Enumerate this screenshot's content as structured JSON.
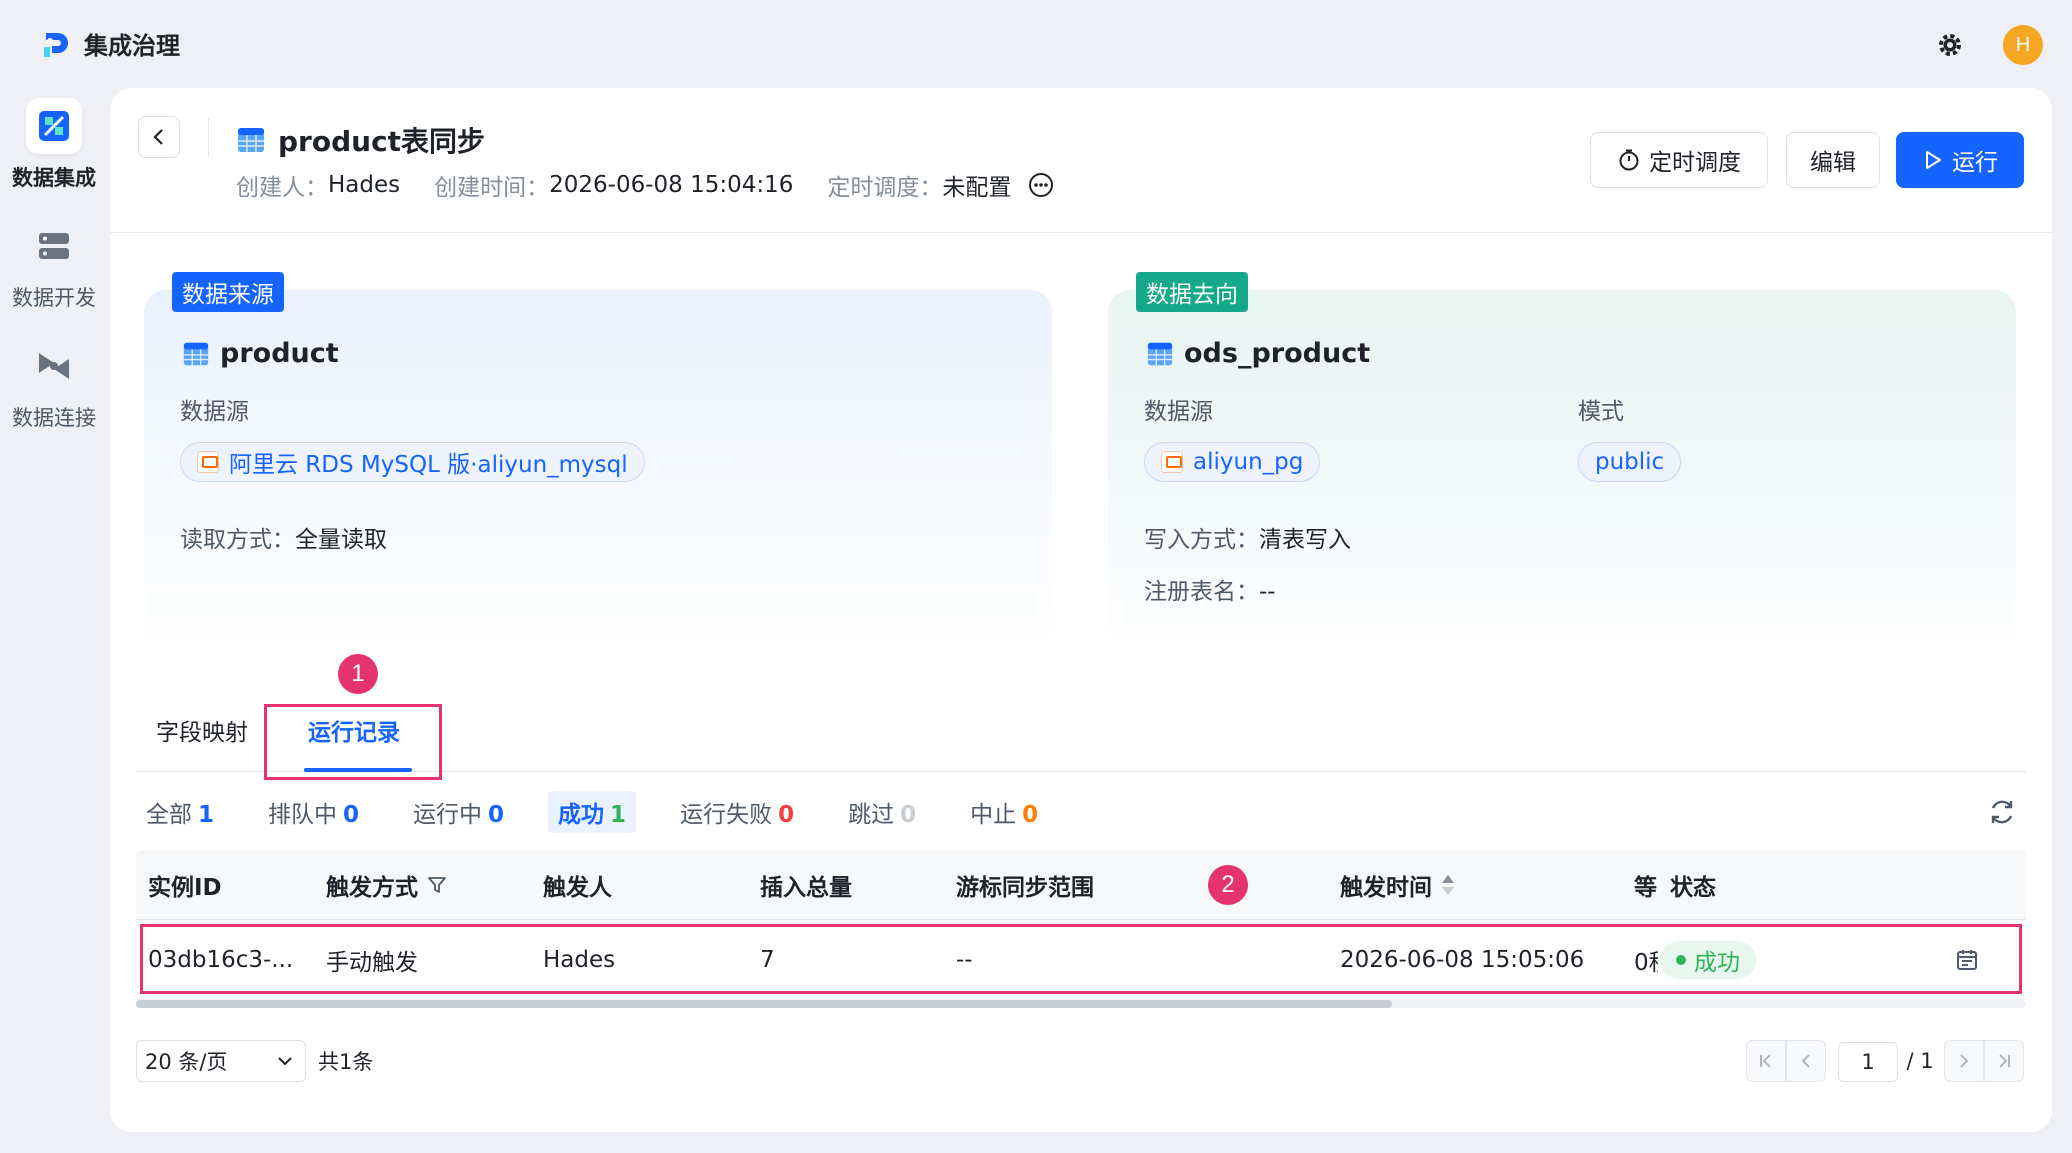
{
  "app": {
    "name": "集成治理",
    "avatar_letter": "H"
  },
  "sidebar": {
    "items": [
      {
        "label": "数据集成",
        "icon": "data-integration-icon",
        "active": true
      },
      {
        "label": "数据开发",
        "icon": "data-development-icon",
        "active": false
      },
      {
        "label": "数据连接",
        "icon": "data-connection-icon",
        "active": false
      }
    ]
  },
  "task": {
    "title": "product表同步",
    "creator_label": "创建人：",
    "creator": "Hades",
    "created_label": "创建时间：",
    "created_at": "2026-06-08 15:04:16",
    "schedule_label": "定时调度：",
    "schedule": "未配置"
  },
  "actions": {
    "schedule": "定时调度",
    "edit": "编辑",
    "run": "运行"
  },
  "source": {
    "tag": "数据来源",
    "table": "product",
    "datasource_label": "数据源",
    "datasource": "阿里云 RDS MySQL 版·aliyun_mysql",
    "read_mode_label": "读取方式：",
    "read_mode": "全量读取"
  },
  "target": {
    "tag": "数据去向",
    "table": "ods_product",
    "datasource_label": "数据源",
    "datasource": "aliyun_pg",
    "schema_label": "模式",
    "schema": "public",
    "write_mode_label": "写入方式：",
    "write_mode": "清表写入",
    "registered_label": "注册表名：",
    "registered": "--"
  },
  "tabs": [
    {
      "label": "字段映射",
      "active": false
    },
    {
      "label": "运行记录",
      "active": true
    }
  ],
  "annotations": {
    "one": "1",
    "two": "2"
  },
  "filters": [
    {
      "label": "全部",
      "count": "1",
      "color": "#1664ff"
    },
    {
      "label": "排队中",
      "count": "0",
      "color": "#1664ff"
    },
    {
      "label": "运行中",
      "count": "0",
      "color": "#1664ff"
    },
    {
      "label": "成功",
      "count": "1",
      "color": "#2fb45a",
      "active": true
    },
    {
      "label": "运行失败",
      "count": "0",
      "color": "#f53f3f"
    },
    {
      "label": "跳过",
      "count": "0",
      "color": "#c9cdd4"
    },
    {
      "label": "中止",
      "count": "0",
      "color": "#ff7d00"
    }
  ],
  "table": {
    "columns": [
      "实例ID",
      "触发方式",
      "触发人",
      "插入总量",
      "游标同步范围",
      "触发时间",
      "等",
      "状态"
    ],
    "rows": [
      {
        "id": "03db16c3-...",
        "trigger_mode": "手动触发",
        "trigger_user": "Hades",
        "insert_total": "7",
        "cursor_range": "--",
        "trigger_time": "2026-06-08 15:05:06",
        "wait": "0秒",
        "status": "成功"
      }
    ]
  },
  "pagination": {
    "page_size": "20 条/页",
    "total": "共1条",
    "current": "1",
    "pages": "/ 1"
  }
}
